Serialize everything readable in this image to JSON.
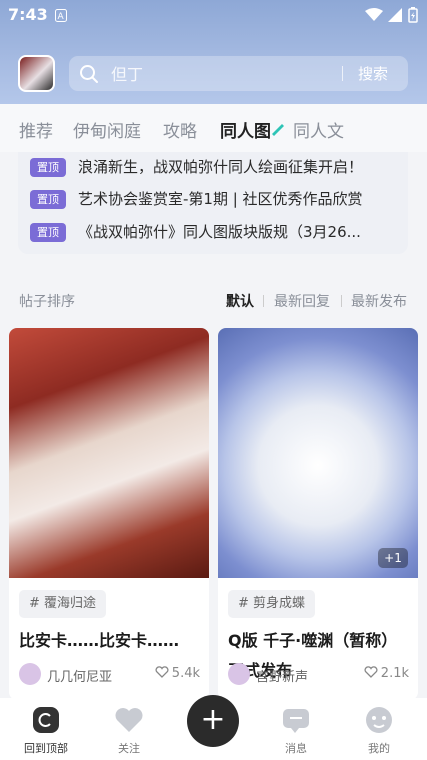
{
  "status_bar": {
    "time": "7:43"
  },
  "search": {
    "placeholder": "但丁",
    "button_label": "搜索"
  },
  "tabs": [
    {
      "label": "推荐"
    },
    {
      "label": "伊甸闲庭"
    },
    {
      "label": "攻略"
    },
    {
      "label": "同人图"
    },
    {
      "label": "同人文"
    }
  ],
  "notices": {
    "badge_label": "置顶",
    "items": [
      {
        "text": "浪涌新生，战双帕弥什同人绘画征集开启！"
      },
      {
        "text": "艺术协会鉴赏室-第1期 | 社区优秀作品欣赏"
      },
      {
        "text": "《战双帕弥什》同人图版块版规（3月26..."
      }
    ]
  },
  "sort": {
    "label": "帖子排序",
    "options": [
      {
        "label": "默认"
      },
      {
        "label": "最新回复"
      },
      {
        "label": "最新发布"
      }
    ]
  },
  "posts": [
    {
      "tag": "# 覆海归途",
      "title": "比安卡……比安卡……",
      "author": "几几何尼亚",
      "likes": "5.4k"
    },
    {
      "tag": "# 剪身成蝶",
      "title": "Q版 千子·噬渊（暂称）正式发布",
      "author": "宫野新声",
      "likes": "2.1k",
      "extra_images": "+1"
    }
  ],
  "bottom_nav": [
    {
      "label": "回到顶部",
      "icon": "refresh-icon"
    },
    {
      "label": "关注",
      "icon": "heart-icon"
    },
    {
      "label": "消息",
      "icon": "message-icon"
    },
    {
      "label": "我的",
      "icon": "profile-icon"
    }
  ],
  "colors": {
    "accent": "#7b6cd6",
    "header": "#a6bbe2",
    "tab_marker": "#2ec4b6"
  }
}
